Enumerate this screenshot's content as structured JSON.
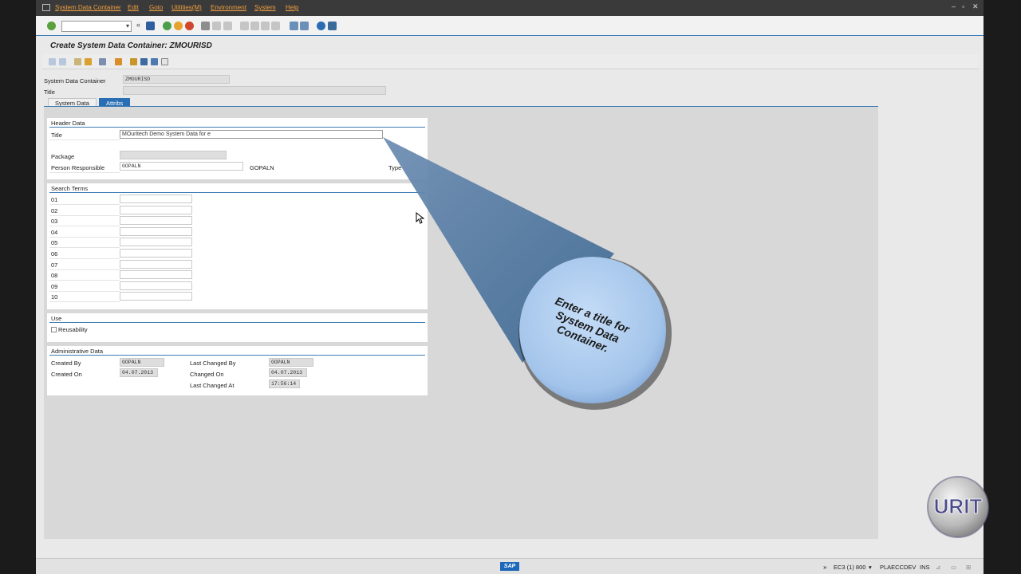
{
  "menubar": {
    "items": [
      "System Data Container",
      "Edit",
      "Goto",
      "Utilities(M)",
      "Environment",
      "System",
      "Help"
    ]
  },
  "screen": {
    "title": "Create System Data Container: ZMOURISD"
  },
  "header": {
    "container_label": "System Data Container",
    "container_value": "ZMOURISD",
    "title_label": "Title",
    "title_value": ""
  },
  "tabs": [
    {
      "label": "System Data",
      "active": false
    },
    {
      "label": "Attribs",
      "active": true
    }
  ],
  "header_data": {
    "heading": "Header Data",
    "title_label": "Title",
    "title_value": "MOuritech Demo System Data for e",
    "package_label": "Package",
    "package_value": "",
    "person_label": "Person Responsible",
    "person_value": "GOPALN",
    "person_name": "GOPALN",
    "type_label": "Type"
  },
  "search_terms": {
    "heading": "Search Terms",
    "rows": [
      "01",
      "02",
      "03",
      "04",
      "05",
      "06",
      "07",
      "08",
      "09",
      "10"
    ]
  },
  "use": {
    "heading": "Use",
    "reusability_label": "Reusability",
    "reusability_checked": false
  },
  "admin": {
    "heading": "Administrative Data",
    "created_by_label": "Created By",
    "created_by_value": "GOPALN",
    "created_on_label": "Created On",
    "created_on_value": "04.07.2013",
    "last_changed_by_label": "Last Changed By",
    "last_changed_by_value": "GOPALN",
    "changed_on_label": "Changed On",
    "changed_on_value": "04.07.2013",
    "last_changed_at_label": "Last Changed At",
    "last_changed_at_value": "17:56:14"
  },
  "callout": {
    "text": "Enter a title for System Data Container."
  },
  "logo": {
    "text": "URIT"
  },
  "statusbar": {
    "sap_label": "SAP",
    "system": "EC3 (1) 800",
    "server": "PLAECCDEV",
    "mode": "INS"
  },
  "colors": {
    "accent": "#3c7cb4",
    "tab_active": "#2a6fb4",
    "menu_text": "#f0a040",
    "callout_fill": "#a9c9ee"
  }
}
